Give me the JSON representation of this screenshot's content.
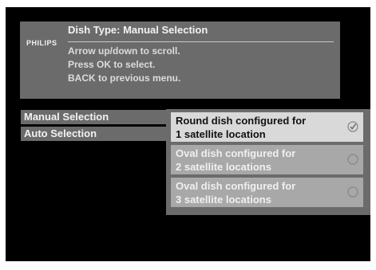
{
  "header": {
    "brand": "PHILIPS",
    "title": "Dish Type: Manual Selection",
    "instructions": [
      "Arrow up/down to scroll.",
      "Press OK to select.",
      "BACK to previous menu."
    ]
  },
  "menu": {
    "items": [
      {
        "label": "Manual Selection"
      },
      {
        "label": "Auto Selection"
      }
    ]
  },
  "options": [
    {
      "line1": "Round dish configured for",
      "line2": "1 satellite location",
      "selected": true,
      "icon": "check-radio-icon"
    },
    {
      "line1": "Oval dish configured for",
      "line2": "2 satellite locations",
      "selected": false,
      "icon": "radio-empty-icon"
    },
    {
      "line1": "Oval dish configured for",
      "line2": "3 satellite locations",
      "selected": false,
      "icon": "radio-empty-icon"
    }
  ],
  "colors": {
    "background": "#000000",
    "panel": "#6b6b6b",
    "option_selected": "#d9d9d9",
    "option_normal": "#a8a8a8"
  }
}
